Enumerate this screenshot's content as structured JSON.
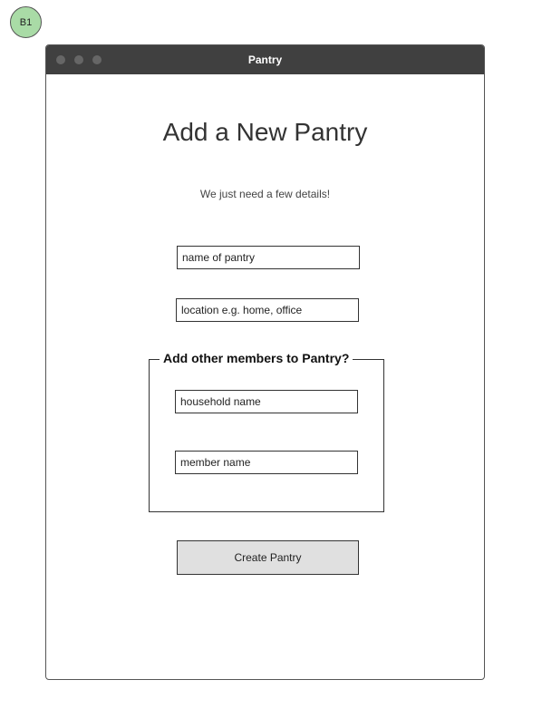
{
  "badge": {
    "label": "B1"
  },
  "window": {
    "title": "Pantry"
  },
  "form": {
    "heading": "Add a New Pantry",
    "subheading": "We just need a few details!",
    "pantry_name": {
      "placeholder": "name of pantry",
      "value": ""
    },
    "location": {
      "placeholder": "location e.g. home, office",
      "value": ""
    },
    "members_group": {
      "legend": "Add other members to Pantry?",
      "household": {
        "placeholder": "household name",
        "value": ""
      },
      "member": {
        "placeholder": "member name",
        "value": ""
      }
    },
    "submit_label": "Create Pantry"
  },
  "colors": {
    "badge_fill": "#a9dba6",
    "titlebar": "#404040",
    "button_fill": "#e0e0e0"
  }
}
